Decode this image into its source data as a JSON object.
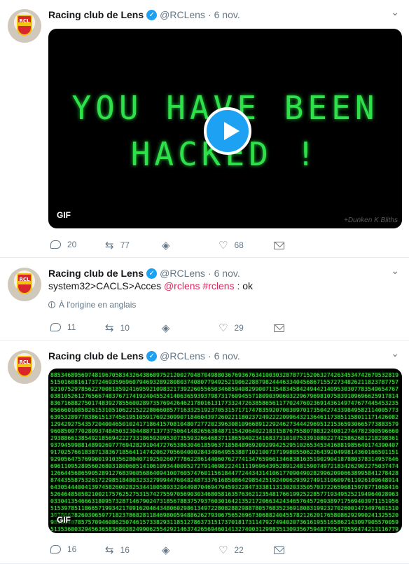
{
  "tweets": [
    {
      "name": "Racing club de Lens",
      "handle": "@RCLens",
      "separator": "·",
      "date": "6 nov.",
      "media": {
        "type": "gif",
        "line1": "YOU HAVE BEEN",
        "line2": "HACKED !",
        "badge": "GIF",
        "watermark": "+Dunken K Bliths"
      },
      "replies": "20",
      "retweets": "77",
      "likes": "68"
    },
    {
      "name": "Racing club de Lens",
      "handle": "@RCLens",
      "separator": "·",
      "date": "6 nov.",
      "text_prefix": "system32>CACLS>Acces ",
      "mention": "@rclens",
      "hashtag": "#rclens",
      "text_suffix": " : ok",
      "origin": "À l'origine en anglais",
      "replies": "11",
      "retweets": "10",
      "likes": "29"
    },
    {
      "name": "Racing club de Lens",
      "handle": "@RCLens",
      "separator": "·",
      "date": "6 nov.",
      "media": {
        "type": "gif",
        "badge": "GIF"
      },
      "replies": "16",
      "retweets": "16",
      "likes": "22"
    }
  ],
  "avatar_text": "RCL",
  "icons": {
    "verified": "verified-badge-icon",
    "caret": "chevron-down-icon",
    "reply": "reply-icon",
    "retweet": "retweet-icon",
    "stack": "stack-icon",
    "like": "heart-icon",
    "dm": "envelope-icon",
    "globe": "globe-icon",
    "play": "play-icon"
  },
  "colors": {
    "accent": "#1da1f2",
    "hashtag": "#e0245e",
    "muted": "#657786",
    "hack_green": "#2ee04a"
  }
}
